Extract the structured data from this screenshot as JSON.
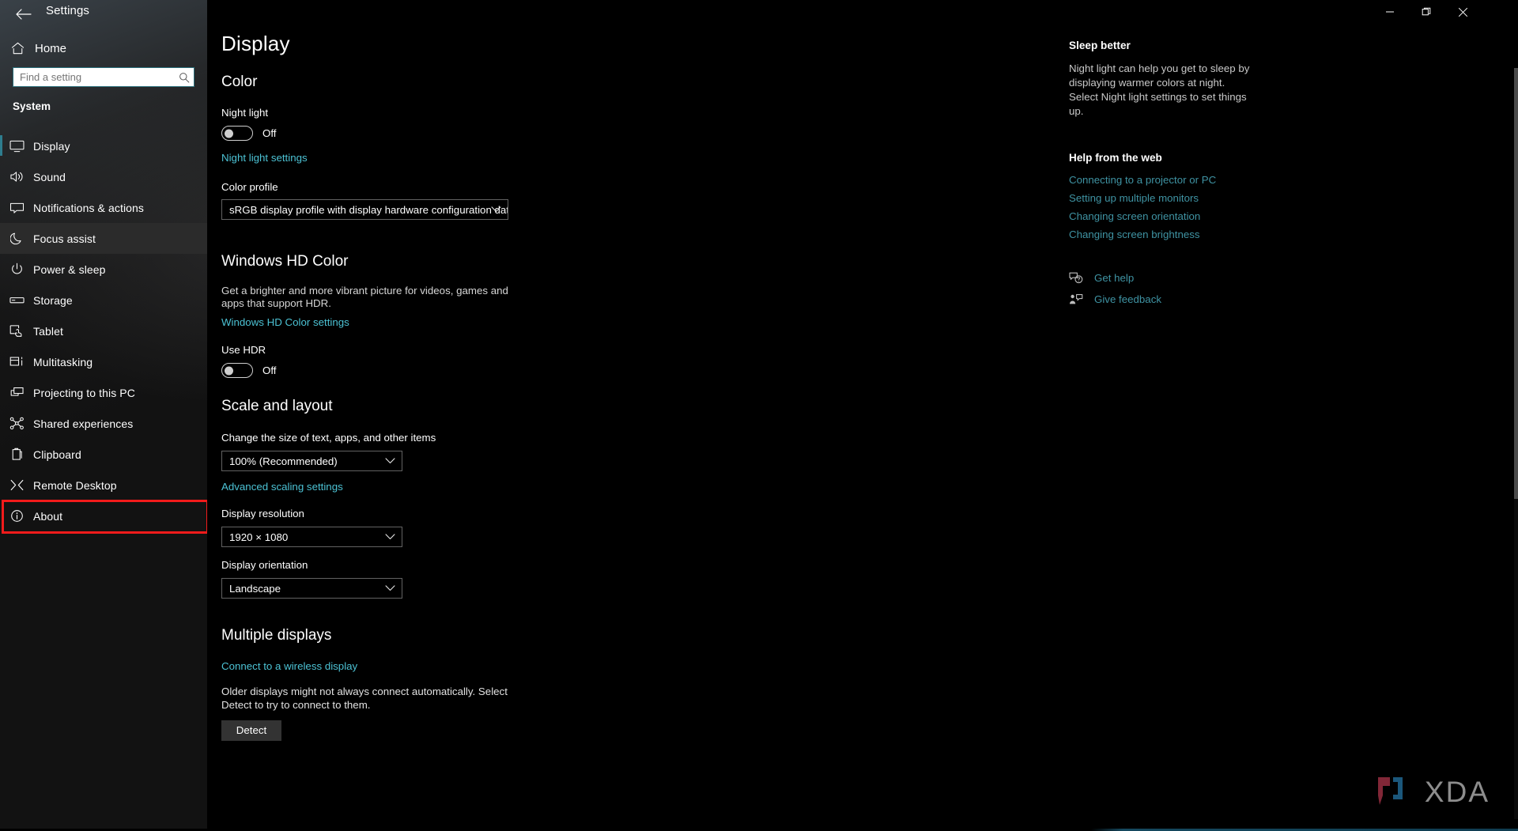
{
  "window": {
    "title": "Settings",
    "back_icon": "back-arrow-icon",
    "minimize_label": "─",
    "maximize_label": "❐",
    "close_label": "✕"
  },
  "sidebar": {
    "home_label": "Home",
    "home_icon": "home-icon",
    "search": {
      "placeholder": "Find a setting",
      "value": "",
      "icon": "search-icon"
    },
    "group_label": "System",
    "items": [
      {
        "label": "Display",
        "icon": "monitor-icon",
        "state": "selected"
      },
      {
        "label": "Sound",
        "icon": "speaker-icon",
        "state": "normal"
      },
      {
        "label": "Notifications & actions",
        "icon": "notification-icon",
        "state": "normal"
      },
      {
        "label": "Focus assist",
        "icon": "moon-icon",
        "state": "hover"
      },
      {
        "label": "Power & sleep",
        "icon": "power-icon",
        "state": "normal"
      },
      {
        "label": "Storage",
        "icon": "drive-icon",
        "state": "normal"
      },
      {
        "label": "Tablet",
        "icon": "tablet-icon",
        "state": "normal"
      },
      {
        "label": "Multitasking",
        "icon": "multitasking-icon",
        "state": "normal"
      },
      {
        "label": "Projecting to this PC",
        "icon": "projecting-icon",
        "state": "normal"
      },
      {
        "label": "Shared experiences",
        "icon": "share-icon",
        "state": "normal"
      },
      {
        "label": "Clipboard",
        "icon": "clipboard-icon",
        "state": "normal"
      },
      {
        "label": "Remote Desktop",
        "icon": "remote-desktop-icon",
        "state": "normal"
      },
      {
        "label": "About",
        "icon": "info-icon",
        "state": "highlighted"
      }
    ],
    "highlight_color": "#f21b1b",
    "accent_color": "#2e7d8e"
  },
  "main": {
    "page_title": "Display",
    "color_section": {
      "heading": "Color",
      "night_light_label": "Night light",
      "night_light_state": "Off",
      "night_light_settings_link": "Night light settings",
      "color_profile_label": "Color profile",
      "color_profile_value": "sRGB display profile with display hardware configuration data d..."
    },
    "hdr_section": {
      "heading": "Windows HD Color",
      "description": "Get a brighter and more vibrant picture for videos, games and apps that support HDR.",
      "settings_link": "Windows HD Color settings",
      "use_hdr_label": "Use HDR",
      "use_hdr_state": "Off"
    },
    "scale_section": {
      "heading": "Scale and layout",
      "scale_label": "Change the size of text, apps, and other items",
      "scale_value": "100% (Recommended)",
      "advanced_scaling_link": "Advanced scaling settings",
      "resolution_label": "Display resolution",
      "resolution_value": "1920 × 1080",
      "orientation_label": "Display orientation",
      "orientation_value": "Landscape"
    },
    "multiple_displays_section": {
      "heading": "Multiple displays",
      "wireless_link": "Connect to a wireless display",
      "description": "Older displays might not always connect automatically. Select Detect to try to connect to them.",
      "detect_button": "Detect"
    }
  },
  "rightpane": {
    "tip_heading": "Sleep better",
    "tip_body": "Night light can help you get to sleep by displaying warmer colors at night. Select Night light settings to set things up.",
    "help_heading": "Help from the web",
    "help_links": [
      "Connecting to a projector or PC",
      "Setting up multiple monitors",
      "Changing screen orientation",
      "Changing screen brightness"
    ],
    "get_help_label": "Get help",
    "get_help_icon": "help-bubble-icon",
    "give_feedback_label": "Give feedback",
    "give_feedback_icon": "feedback-icon"
  },
  "watermark": {
    "text": "XDA",
    "icon": "xda-bracket-logo"
  }
}
